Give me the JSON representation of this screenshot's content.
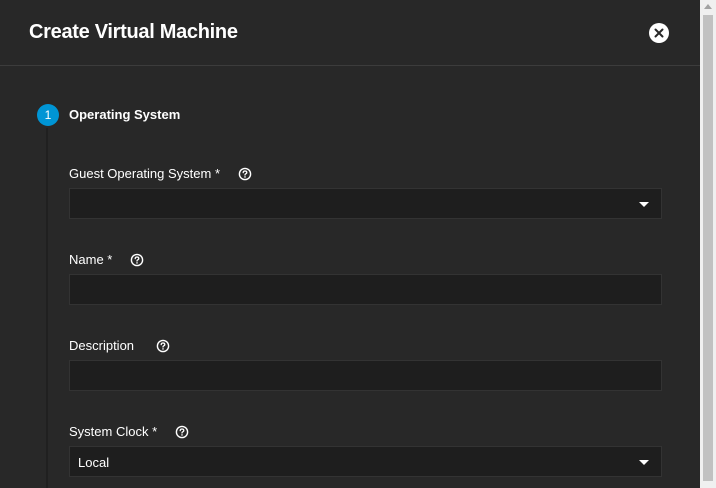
{
  "dialog": {
    "title": "Create Virtual Machine",
    "close_icon": "close-icon"
  },
  "step": {
    "number": "1",
    "title": "Operating System"
  },
  "fields": {
    "guest_os": {
      "label": "Guest Operating System *",
      "value": ""
    },
    "name": {
      "label": "Name *",
      "value": ""
    },
    "description": {
      "label": "Description",
      "value": ""
    },
    "system_clock": {
      "label": "System Clock *",
      "value": "Local"
    }
  },
  "colors": {
    "background": "#282828",
    "field_background": "#1e1e1e",
    "accent": "#0095d5",
    "text": "#ffffff"
  }
}
